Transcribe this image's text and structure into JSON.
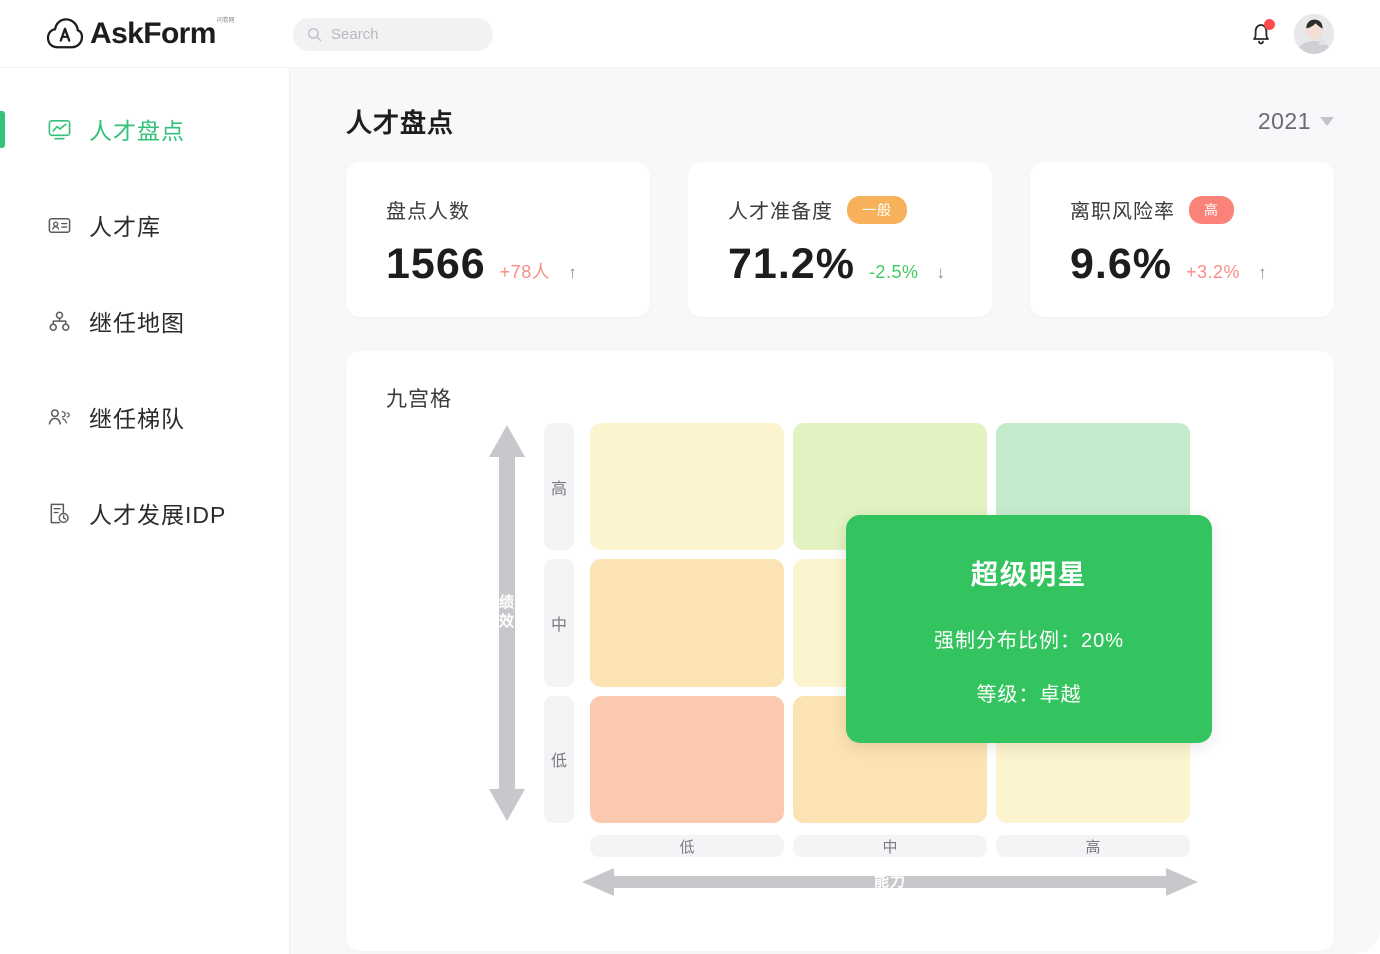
{
  "brand": {
    "name": "AskForm",
    "badge": "问卷网"
  },
  "search": {
    "placeholder": "Search",
    "value": "",
    "icon": "search-icon"
  },
  "topbar": {
    "bell_icon": "bell-icon",
    "avatar_icon": "user-avatar",
    "has_notification": true
  },
  "sidebar": {
    "items": [
      {
        "label": "人才盘点",
        "icon": "chart-board-icon",
        "active": true
      },
      {
        "label": "人才库",
        "icon": "id-card-icon",
        "active": false
      },
      {
        "label": "继任地图",
        "icon": "org-node-icon",
        "active": false
      },
      {
        "label": "继任梯队",
        "icon": "users-group-icon",
        "active": false
      },
      {
        "label": "人才发展IDP",
        "icon": "doc-clock-icon",
        "active": false
      }
    ]
  },
  "page": {
    "title": "人才盘点",
    "year": "2021",
    "caret_icon": "chevron-down-icon"
  },
  "stats": [
    {
      "name": "盘点人数",
      "badge": null,
      "badge_color": null,
      "value": "1566",
      "delta": "+78人",
      "delta_color": "#f88e86",
      "arrow": "↑"
    },
    {
      "name": "人才准备度",
      "badge": "一般",
      "badge_color": "#f6b15a",
      "value": "71.2%",
      "delta": "-2.5%",
      "delta_color": "#3fcc63",
      "arrow": "↓"
    },
    {
      "name": "离职风险率",
      "badge": "高",
      "badge_color": "#fa8278",
      "value": "9.6%",
      "delta": "+3.2%",
      "delta_color": "#f88e86",
      "arrow": "↑"
    }
  ],
  "nine_grid": {
    "title": "九宫格",
    "y_axis_label": "绩效",
    "x_axis_label": "能力",
    "y_ticks": [
      "高",
      "中",
      "低"
    ],
    "x_ticks": [
      "低",
      "中",
      "高"
    ],
    "cells": [
      {
        "row": "高",
        "col": "低",
        "color": "#fcf3cf"
      },
      {
        "row": "高",
        "col": "中",
        "color": "#e2f2c0"
      },
      {
        "row": "高",
        "col": "高",
        "color": "#c5ebcd"
      },
      {
        "row": "中",
        "col": "低",
        "color": "#fce3b4"
      },
      {
        "row": "中",
        "col": "中",
        "color": "#fcf3cf"
      },
      {
        "row": "中",
        "col": "高",
        "color": "#e2f2c0"
      },
      {
        "row": "低",
        "col": "低",
        "color": "#fbc9b0"
      },
      {
        "row": "低",
        "col": "中",
        "color": "#fce3b4"
      },
      {
        "row": "低",
        "col": "高",
        "color": "#fcf3cf"
      }
    ],
    "tooltip": {
      "title": "超级明星",
      "line1": "强制分布比例：20%",
      "line2": "等级：卓越",
      "bg_color": "#34c45f"
    }
  },
  "theme": {
    "accent": "#34c17b",
    "content_bg": "#f7f8fa"
  }
}
